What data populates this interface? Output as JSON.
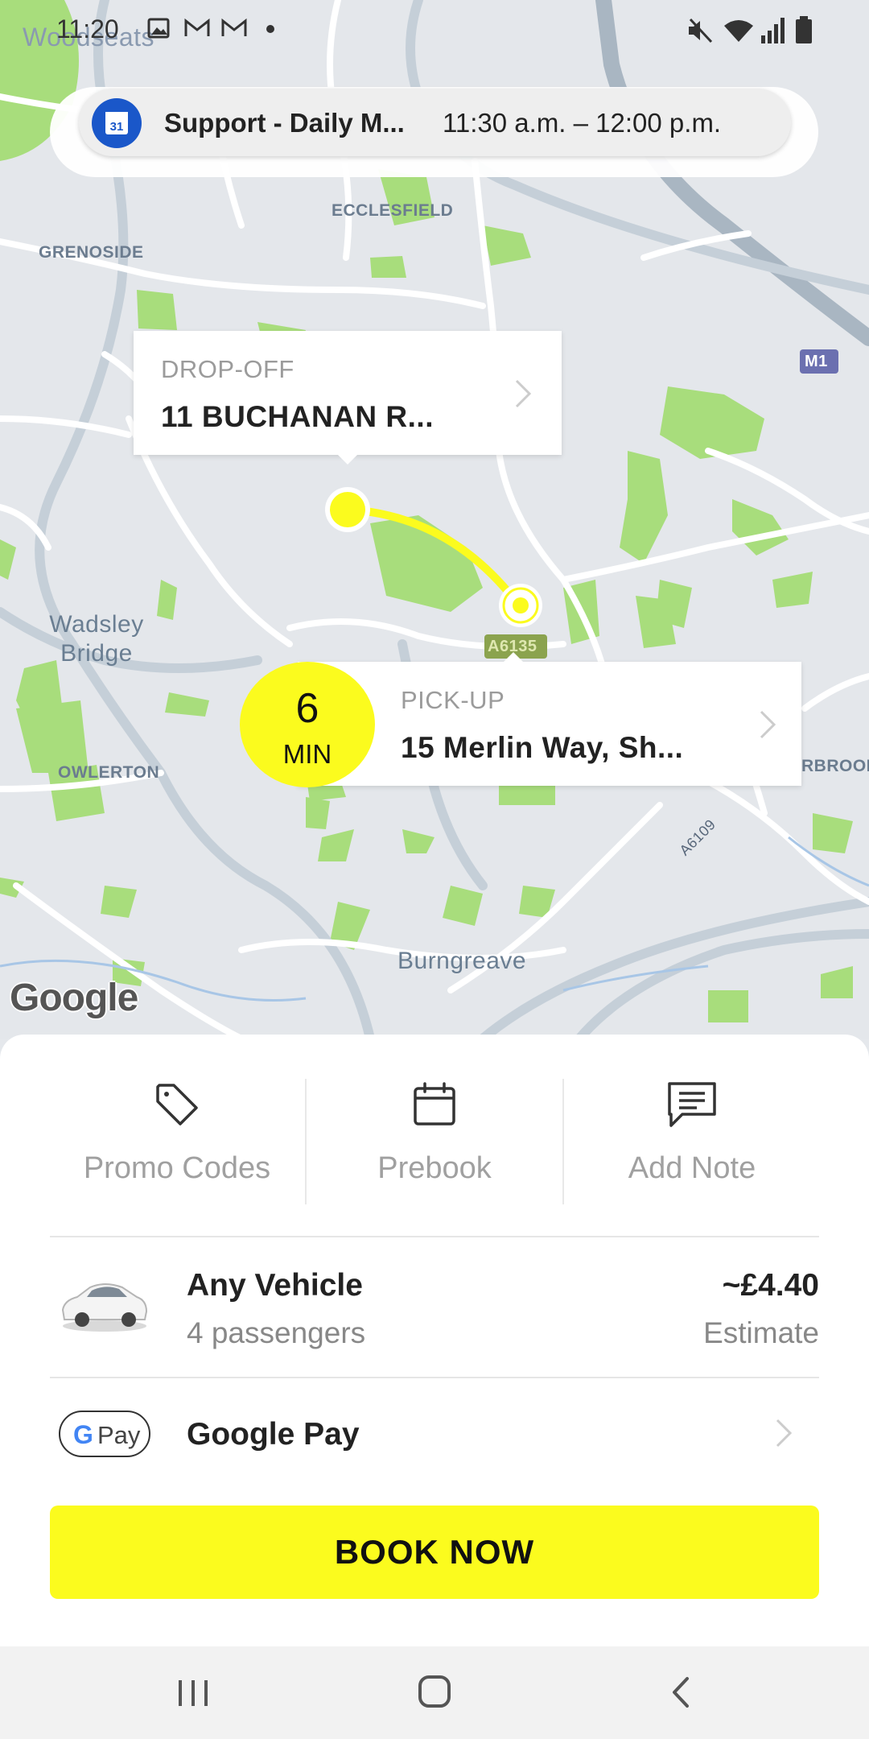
{
  "status_bar": {
    "time": "11:20",
    "icons": [
      "gallery-icon",
      "gmail-icon",
      "gmail-icon",
      "dot-icon",
      "mute-icon",
      "wifi-icon",
      "signal-icon",
      "battery-icon"
    ]
  },
  "notification": {
    "icon": "calendar-31-icon",
    "icon_text": "31",
    "title": "Support - Daily M...",
    "time": "11:30 a.m. – 12:00 p.m."
  },
  "map": {
    "labels": {
      "woodseats": "Woodseats",
      "ecclesfield": "ECCLESFIELD",
      "grenoside": "GRENOSIDE",
      "wadsley_bridge": "Wadsley Bridge",
      "owlerton": "OWLERTON",
      "burngreave": "Burngreave",
      "harbrook": "RBROOK",
      "a6135": "A6135",
      "a6109": "A6109",
      "m1": "M1"
    },
    "attribution": "Google"
  },
  "dropoff": {
    "label": "DROP-OFF",
    "address": "11 BUCHANAN R..."
  },
  "pickup": {
    "label": "PICK-UP",
    "address": "15 Merlin Way, Sh...",
    "eta_value": "6",
    "eta_unit": "MIN"
  },
  "actions": [
    {
      "label": "Promo Codes",
      "icon": "tag-icon"
    },
    {
      "label": "Prebook",
      "icon": "calendar-icon"
    },
    {
      "label": "Add Note",
      "icon": "note-icon"
    }
  ],
  "vehicle": {
    "name": "Any Vehicle",
    "passengers": "4 passengers",
    "price": "~£4.40",
    "price_note": "Estimate"
  },
  "payment": {
    "method": "Google Pay",
    "badge_g": "G",
    "badge_pay": "Pay"
  },
  "book_button": "BOOK NOW",
  "colors": {
    "accent_yellow": "#fbfb1e",
    "map_background": "#e4e7eb",
    "park_green": "#a8dd7c"
  }
}
